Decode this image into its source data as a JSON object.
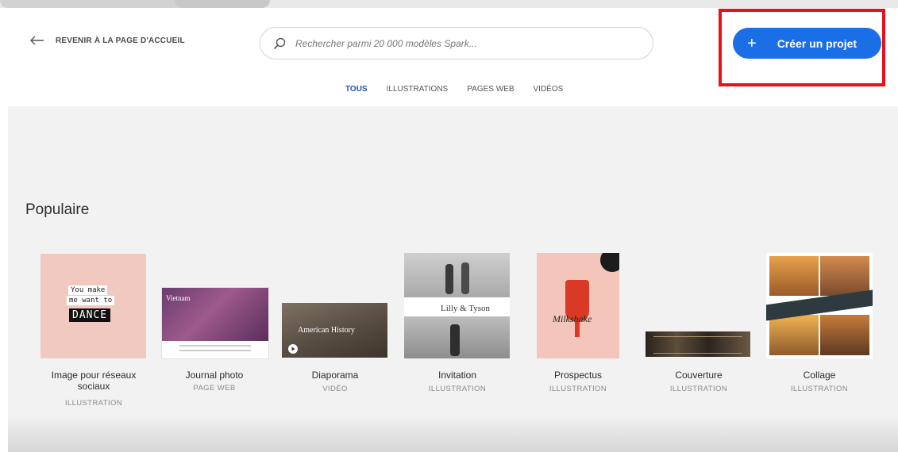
{
  "header": {
    "back_label": "REVENIR À LA PAGE D'ACCUEIL",
    "search_placeholder": "Rechercher parmi 20 000 modèles Spark...",
    "cta_label": "Créer un projet",
    "cta_plus": "+"
  },
  "tabs": [
    {
      "label": "TOUS",
      "active": true
    },
    {
      "label": "ILLUSTRATIONS",
      "active": false
    },
    {
      "label": "PAGES WEB",
      "active": false
    },
    {
      "label": "VIDÉOS",
      "active": false
    }
  ],
  "section": {
    "title": "Populaire"
  },
  "cards": [
    {
      "title": "Image pour réseaux sociaux",
      "type": "ILLUSTRATION",
      "thumb_text": [
        "You make",
        "me want to",
        "DANCE"
      ]
    },
    {
      "title": "Journal photo",
      "type": "PAGE WEB",
      "thumb_text": [
        "Vietnam"
      ]
    },
    {
      "title": "Diaporama",
      "type": "VIDÉO",
      "thumb_text": [
        "American History"
      ]
    },
    {
      "title": "Invitation",
      "type": "ILLUSTRATION",
      "thumb_text": [
        "Lilly & Tyson"
      ]
    },
    {
      "title": "Prospectus",
      "type": "ILLUSTRATION",
      "thumb_text": [
        "Milkshake"
      ]
    },
    {
      "title": "Couverture",
      "type": "ILLUSTRATION",
      "thumb_text": []
    },
    {
      "title": "Collage",
      "type": "ILLUSTRATION",
      "thumb_text": []
    }
  ],
  "colors": {
    "accent": "#1a6ee6",
    "highlight": "#e8101a",
    "background": "#f2f2f2"
  }
}
